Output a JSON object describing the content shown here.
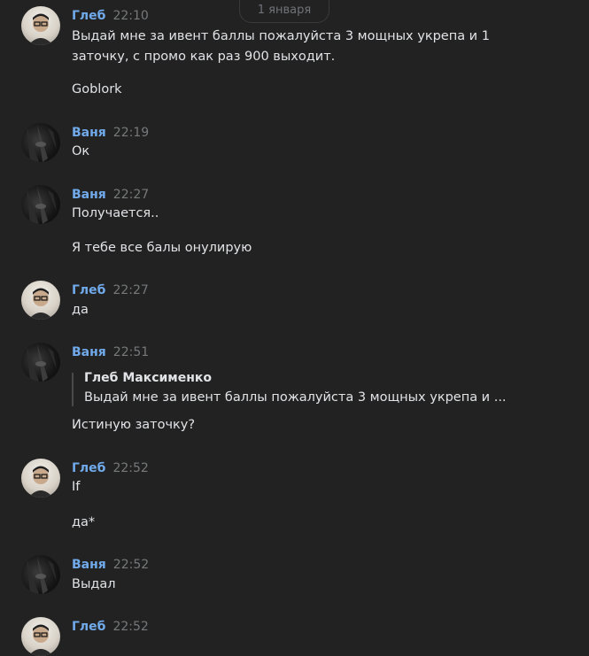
{
  "date_label": "1 января",
  "messages": [
    {
      "author": "Глеб",
      "time": "22:10",
      "lines": [
        "Выдай мне за ивент баллы пожалуйста 3 мощных укрепа и 1",
        "заточку, с промо как раз 900 выходит.",
        "Goblork"
      ]
    },
    {
      "author": "Ваня",
      "time": "22:19",
      "lines": [
        "Ок"
      ]
    },
    {
      "author": "Ваня",
      "time": "22:27",
      "lines": [
        "Получается..",
        "Я тебе все балы онулирую"
      ]
    },
    {
      "author": "Глеб",
      "time": "22:27",
      "lines": [
        "да"
      ]
    },
    {
      "author": "Ваня",
      "time": "22:51",
      "reply": {
        "author": "Глеб Максименко",
        "text": "Выдай мне за ивент баллы пожалуйста 3 мощных укрепа и ..."
      },
      "lines": [
        "Истиную заточку?"
      ]
    },
    {
      "author": "Глеб",
      "time": "22:52",
      "lines": [
        "If",
        "да*"
      ]
    },
    {
      "author": "Ваня",
      "time": "22:52",
      "lines": [
        "Выдал"
      ]
    },
    {
      "author": "Глеб",
      "time": "22:52",
      "lines": []
    }
  ],
  "colors": {
    "background": "#222222",
    "author_name": "#71aaeb",
    "timestamp": "#76787a",
    "text": "#e1e3e6"
  }
}
